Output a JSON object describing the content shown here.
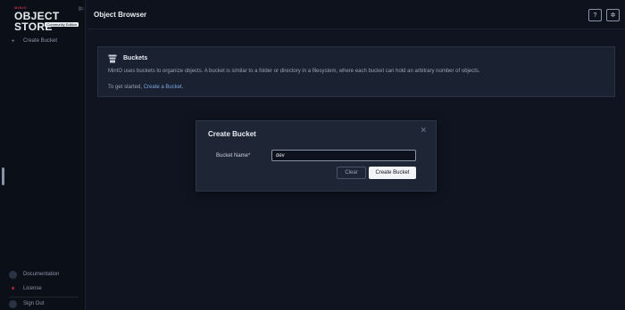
{
  "sidebar": {
    "logo_brand": "MINIO",
    "logo_product": "OBJECT STORE",
    "logo_edition": "Community Edition",
    "collapse_icon": "collapse-icon",
    "create_bucket": "Create Bucket",
    "documentation": "Documentation",
    "license": "License",
    "sign_out": "Sign Out"
  },
  "header": {
    "title": "Object Browser",
    "help_icon": "help-icon",
    "settings_icon": "settings-icon"
  },
  "banner": {
    "title": "Buckets",
    "description": "MinIO uses buckets to organize objects. A bucket is similar to a folder or directory in a filesystem, where each bucket can hold an arbitrary number of objects.",
    "start_prefix": "To get started, ",
    "start_link": "Create a Bucket",
    "start_suffix": "."
  },
  "modal": {
    "title": "Create Bucket",
    "bucket_name_label": "Bucket Name*",
    "bucket_name_value": "dev",
    "clear_label": "Clear",
    "create_label": "Create Bucket"
  },
  "colors": {
    "background": "#0f1420",
    "sidebar": "#0b1018",
    "accent_red": "#c72c48",
    "link": "#7aa6e0"
  }
}
